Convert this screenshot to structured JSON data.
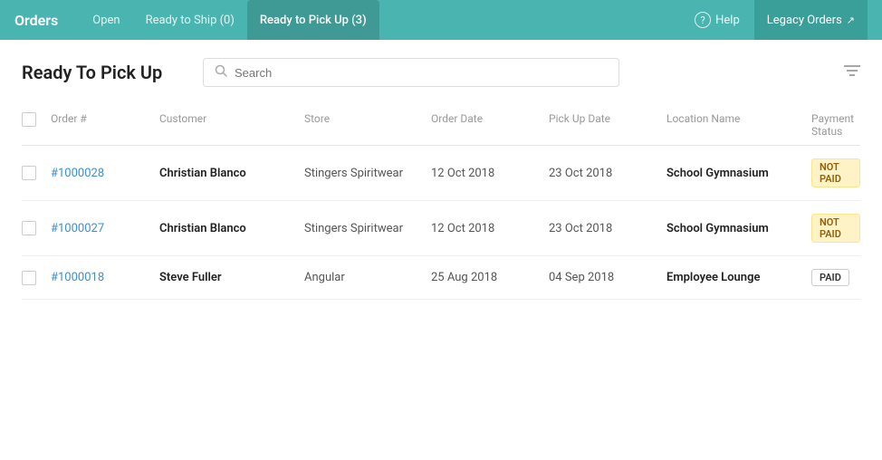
{
  "header": {
    "title": "Orders",
    "nav": [
      {
        "label": "Open",
        "active": false
      },
      {
        "label": "Ready to Ship (0)",
        "active": false
      },
      {
        "label": "Ready to Pick Up (3)",
        "active": true
      }
    ],
    "help_label": "Help",
    "legacy_label": "Legacy Orders"
  },
  "page": {
    "title": "Ready To Pick Up",
    "search_placeholder": "Search",
    "filter_icon": "≡"
  },
  "table": {
    "columns": [
      {
        "key": "checkbox",
        "label": ""
      },
      {
        "key": "order_num",
        "label": "Order #"
      },
      {
        "key": "customer",
        "label": "Customer"
      },
      {
        "key": "store",
        "label": "Store"
      },
      {
        "key": "order_date",
        "label": "Order Date"
      },
      {
        "key": "pickup_date",
        "label": "Pick Up Date"
      },
      {
        "key": "location",
        "label": "Location Name"
      },
      {
        "key": "payment",
        "label": "Payment Status"
      }
    ],
    "rows": [
      {
        "order_num": "#1000028",
        "customer": "Christian Blanco",
        "store": "Stingers Spiritwear",
        "order_date": "12 Oct 2018",
        "pickup_date": "23 Oct 2018",
        "location": "School Gymnasium",
        "payment": "NOT PAID",
        "payment_type": "not-paid"
      },
      {
        "order_num": "#1000027",
        "customer": "Christian Blanco",
        "store": "Stingers Spiritwear",
        "order_date": "12 Oct 2018",
        "pickup_date": "23 Oct 2018",
        "location": "School Gymnasium",
        "payment": "NOT PAID",
        "payment_type": "not-paid"
      },
      {
        "order_num": "#1000018",
        "customer": "Steve Fuller",
        "store": "Angular",
        "order_date": "25 Aug 2018",
        "pickup_date": "04 Sep 2018",
        "location": "Employee Lounge",
        "payment": "PAID",
        "payment_type": "paid"
      }
    ]
  }
}
